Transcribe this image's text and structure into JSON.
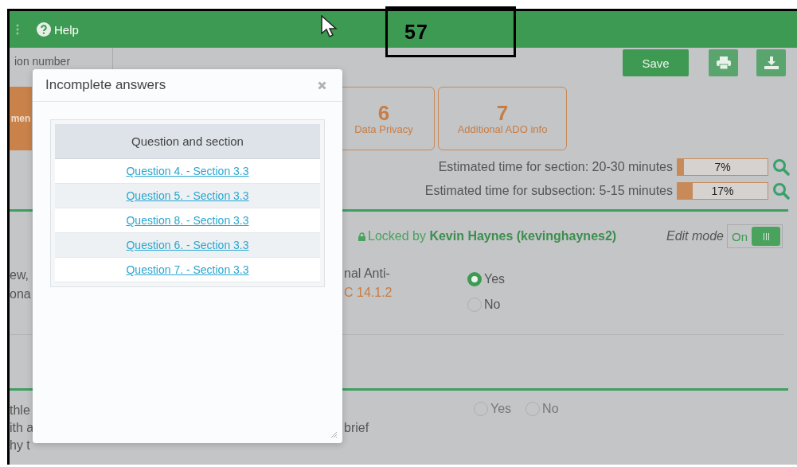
{
  "header": {
    "help": "Help"
  },
  "annotation": "57",
  "toolbar": {
    "field_value": "ion number",
    "save": "Save"
  },
  "tabs": [
    {
      "label": "men",
      "selected": true
    },
    {
      "number": "6",
      "label": "Data Privacy",
      "selected": false
    },
    {
      "number": "7",
      "label": "Additional ADO info",
      "selected": false
    }
  ],
  "estimates": [
    {
      "label": "Estimated time for section: 20-30 minutes",
      "level": 0.07,
      "reading": "7%"
    },
    {
      "label": "Estimated time for subsection: 5-15 minutes",
      "level": 0.17,
      "reading": "17%"
    }
  ],
  "lock": {
    "prefix": "Locked by",
    "user": "Kevin Haynes (kevinghaynes2)"
  },
  "edit_mode": {
    "label": "Edit mode",
    "state_text": "On",
    "on": true
  },
  "questions": [
    {
      "kind": "stacked",
      "left_lines": [
        "ew,",
        "ona"
      ],
      "right_lines": [
        "nal Anti-"
      ],
      "reference": "C 14.1.2",
      "options": [
        {
          "label": "Yes",
          "selected": true
        },
        {
          "label": "No",
          "selected": false
        }
      ]
    },
    {
      "kind": "inline",
      "left_lines": [
        "thle",
        "ith a",
        "hy t"
      ],
      "right_lines": [
        "brief"
      ],
      "options": [
        {
          "label": "Yes",
          "selected": false
        },
        {
          "label": "No",
          "selected": false
        }
      ]
    }
  ],
  "modal": {
    "title": "Incomplete answers",
    "column": "Question and section",
    "rows": [
      "Question 4. - Section 3.3",
      "Question 5. - Section 3.3",
      "Question 8. - Section 3.3",
      "Question 6. - Section 3.3",
      "Question 7. - Section 3.3"
    ]
  }
}
